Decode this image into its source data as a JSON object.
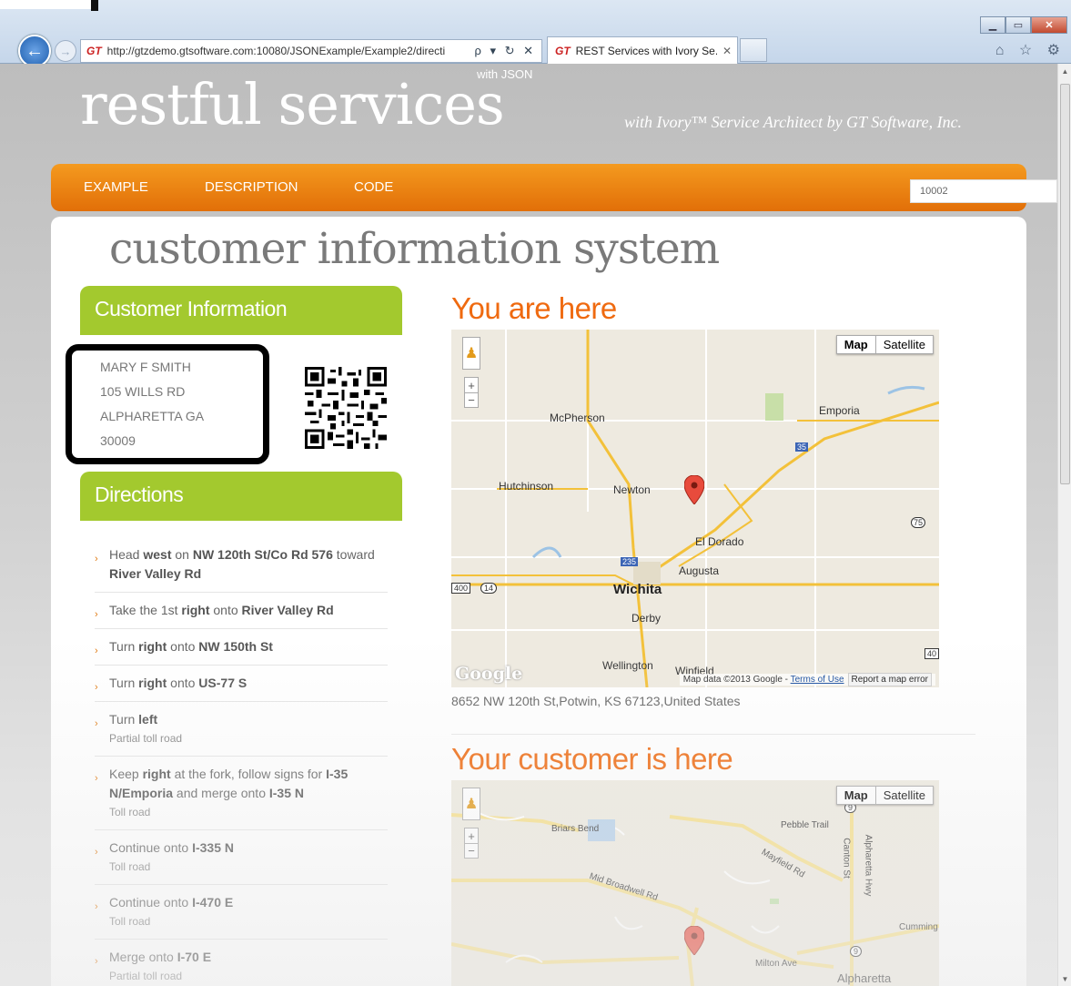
{
  "browser": {
    "url": "http://gtzdemo.gtsoftware.com:10080/JSONExample/Example2/directi",
    "addr_tools": "ρ ▾ ↻ ✕",
    "tab_title": "REST Services with Ivory Se...",
    "tab_close": "✕",
    "gt": "GT",
    "chrome_icons": "⌂ ☆ ⚙"
  },
  "header": {
    "title": "restful services",
    "with_json": "with JSON",
    "tagline": "with Ivory™ Service Architect by GT Software, Inc."
  },
  "nav": {
    "items": [
      "EXAMPLE",
      "DESCRIPTION",
      "CODE"
    ],
    "search_value": "10002"
  },
  "page": {
    "title": "customer information system"
  },
  "customer": {
    "heading": "Customer Information",
    "lines": [
      "MARY F SMITH",
      "105 WILLS RD",
      "ALPHARETTA GA",
      "30009"
    ]
  },
  "directions": {
    "heading": "Directions",
    "steps": [
      {
        "html_parts": [
          "Head ",
          "west",
          " on ",
          "NW 120th St/Co Rd 576",
          " toward ",
          "River Valley Rd"
        ],
        "sub": ""
      },
      {
        "html_parts": [
          "Take the 1st ",
          "right",
          " onto ",
          "River Valley Rd"
        ],
        "sub": ""
      },
      {
        "html_parts": [
          "Turn ",
          "right",
          " onto ",
          "NW 150th St"
        ],
        "sub": ""
      },
      {
        "html_parts": [
          "Turn ",
          "right",
          " onto ",
          "US-77 S"
        ],
        "sub": ""
      },
      {
        "html_parts": [
          "Turn ",
          "left"
        ],
        "sub": "Partial toll road"
      },
      {
        "html_parts": [
          "Keep ",
          "right",
          " at the fork, follow signs for ",
          "I-35 N/Emporia",
          " and merge onto ",
          "I-35 N"
        ],
        "sub": "Toll road"
      },
      {
        "html_parts": [
          "Continue onto ",
          "I-335 N"
        ],
        "sub": "Toll road"
      },
      {
        "html_parts": [
          "Continue onto ",
          "I-470 E"
        ],
        "sub": "Toll road"
      },
      {
        "html_parts": [
          "Merge onto ",
          "I-70 E"
        ],
        "sub": "Partial toll road"
      }
    ]
  },
  "you_are_here": {
    "heading": "You are here",
    "address": "8652 NW 120th St,Potwin, KS 67123,United States",
    "map": {
      "type_map": "Map",
      "type_satellite": "Satellite",
      "zoom_in": "+",
      "zoom_out": "−",
      "google": "Google",
      "credit": "Map data ©2013 Google - ",
      "terms": "Terms of Use",
      "report": "Report a map error",
      "labels": [
        "McPherson",
        "Emporia",
        "Hutchinson",
        "Newton",
        "El Dorado",
        "Augusta",
        "Wichita",
        "Derby",
        "Wellington",
        "Winfield"
      ],
      "shields": [
        "35",
        "75",
        "235",
        "400",
        "14",
        "40"
      ]
    }
  },
  "customer_here": {
    "heading": "Your customer is here",
    "map": {
      "type_map": "Map",
      "type_satellite": "Satellite",
      "zoom_in": "+",
      "zoom_out": "−",
      "labels": [
        "Briars Bend",
        "Pebble Trail",
        "Mayfield Rd",
        "Canton St",
        "Alpharetta Hwy",
        "Mid Broadwell Rd",
        "Cumming",
        "Milton Ave",
        "Alpharetta"
      ],
      "shields": [
        "9",
        "9"
      ]
    }
  }
}
